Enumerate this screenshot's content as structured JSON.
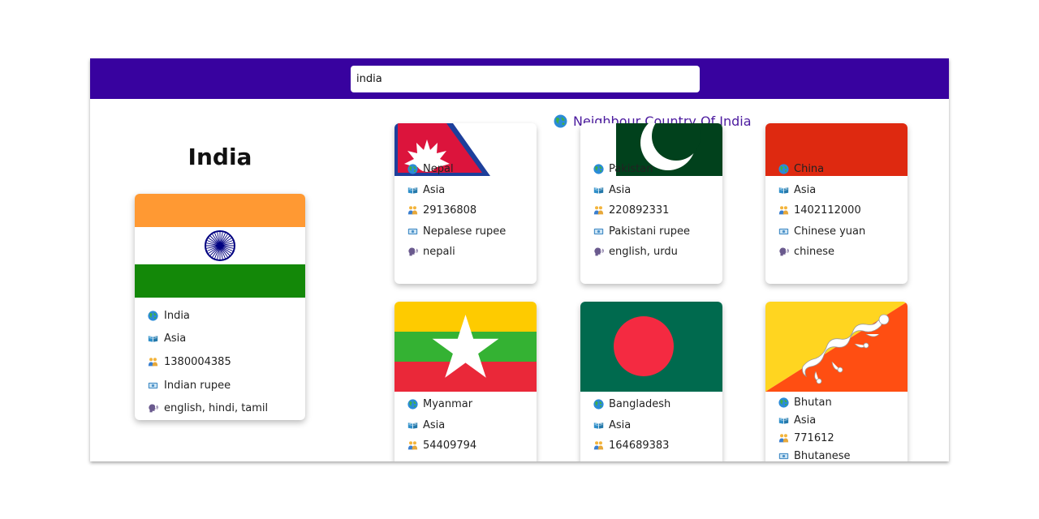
{
  "search": {
    "value": "india"
  },
  "neighbour_heading": "Neighbour Country Of India",
  "main_country": {
    "name": "India",
    "rows": [
      {
        "icon": "globe-icon",
        "text": "India"
      },
      {
        "icon": "book-icon",
        "text": "Asia"
      },
      {
        "icon": "people-icon",
        "text": "1380004385"
      },
      {
        "icon": "money-icon",
        "text": "Indian rupee"
      },
      {
        "icon": "speech-icon",
        "text": "english, hindi, tamil"
      }
    ]
  },
  "neighbours": [
    {
      "name": "Nepal",
      "region": "Asia",
      "population": "29136808",
      "currency": "Nepalese rupee",
      "languages": "nepali"
    },
    {
      "name": "Pakistan",
      "region": "Asia",
      "population": "220892331",
      "currency": "Pakistani rupee",
      "languages": "english, urdu"
    },
    {
      "name": "China",
      "region": "Asia",
      "population": "1402112000",
      "currency": "Chinese yuan",
      "languages": "chinese"
    },
    {
      "name": "Myanmar",
      "region": "Asia",
      "population": "54409794"
    },
    {
      "name": "Bangladesh",
      "region": "Asia",
      "population": "164689383"
    },
    {
      "name": "Bhutan",
      "region": "Asia",
      "population": "771612",
      "currency": "Bhutanese"
    }
  ],
  "colors": {
    "topbar": "#38029f",
    "heading": "#4b1a9e",
    "india_saffron": "#ff9933",
    "india_green": "#138808",
    "chakra": "#000080"
  }
}
